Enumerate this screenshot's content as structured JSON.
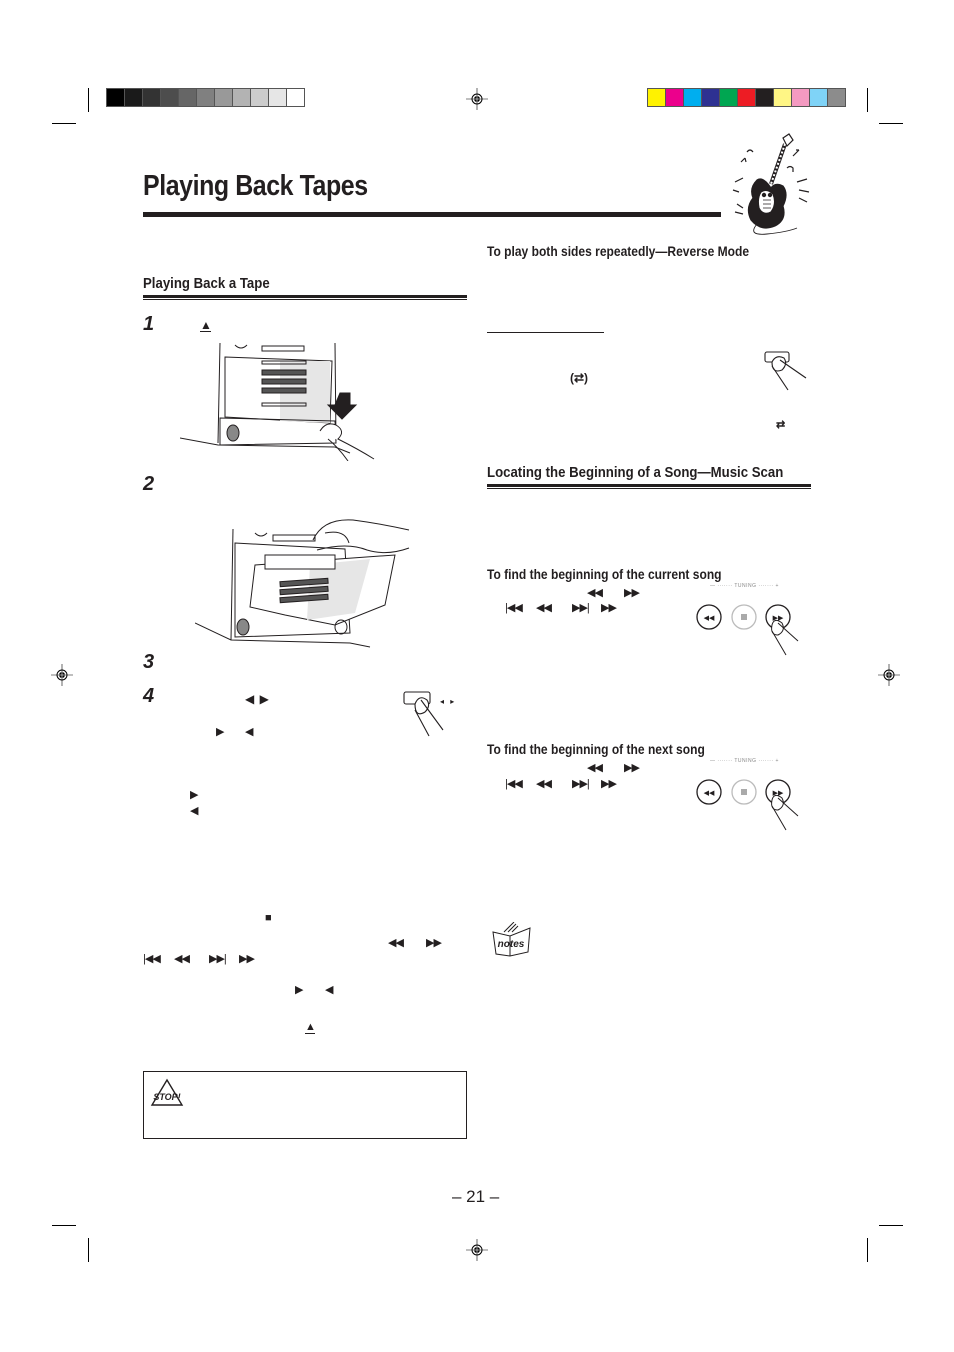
{
  "page": {
    "title": "Playing Back Tapes",
    "page_number": "– 21 –"
  },
  "print_marks": {
    "grayscale_bar": [
      "#000000",
      "#1a1a1a",
      "#333333",
      "#4d4d4d",
      "#666666",
      "#808080",
      "#999999",
      "#b3b3b3",
      "#cccccc",
      "#e6e6e6",
      "#ffffff"
    ],
    "color_bar": [
      "#fff200",
      "#ec008c",
      "#00aeef",
      "#2e3192",
      "#00a651",
      "#ed1c24",
      "#231f20",
      "#fff685",
      "#f49ac1",
      "#7fd3f7",
      "#8c8c8c"
    ]
  },
  "left_column": {
    "section_heading": "Playing Back a Tape",
    "steps": [
      {
        "number": "1",
        "symbols": "▲"
      },
      {
        "number": "2",
        "symbols": ""
      },
      {
        "number": "3",
        "symbols": ""
      },
      {
        "number": "4",
        "symbols": "◀ ▶"
      }
    ],
    "step4_button_symbols": "◂ ▸",
    "direction_symbols": {
      "play_forward": "▶",
      "play_reverse": "◀",
      "pair_a": "▶",
      "pair_b": "◀"
    },
    "stop_symbol": "■",
    "search_symbols_a": "◀◀",
    "search_symbols_b": "▶▶",
    "skip_symbols": [
      "|◀◀",
      "◀◀",
      "▶▶|",
      "▶▶"
    ],
    "play_symbols": [
      "▶",
      "◀"
    ],
    "eject_symbol": "▲",
    "stop_box": {
      "icon": "STOP!"
    }
  },
  "right_column": {
    "reverse_mode": {
      "heading": "To play both sides repeatedly—Reverse Mode",
      "indicator": "(⇄)",
      "indicator_small": "⇄"
    },
    "music_scan": {
      "heading": "Locating the Beginning of a Song—Music Scan",
      "current_song": {
        "heading": "To find the beginning of the current song",
        "symbols_a": [
          "◀◀",
          "▶▶"
        ],
        "symbols_b": [
          "|◀◀",
          "◀◀",
          "▶▶|",
          "▶▶"
        ],
        "panel_label": "TUNING"
      },
      "next_song": {
        "heading": "To find the beginning of the next song",
        "symbols_a": [
          "◀◀",
          "▶▶"
        ],
        "symbols_b": [
          "|◀◀",
          "◀◀",
          "▶▶|",
          "▶▶"
        ],
        "panel_label": "TUNING"
      }
    },
    "notes_icon_label": "notes"
  }
}
